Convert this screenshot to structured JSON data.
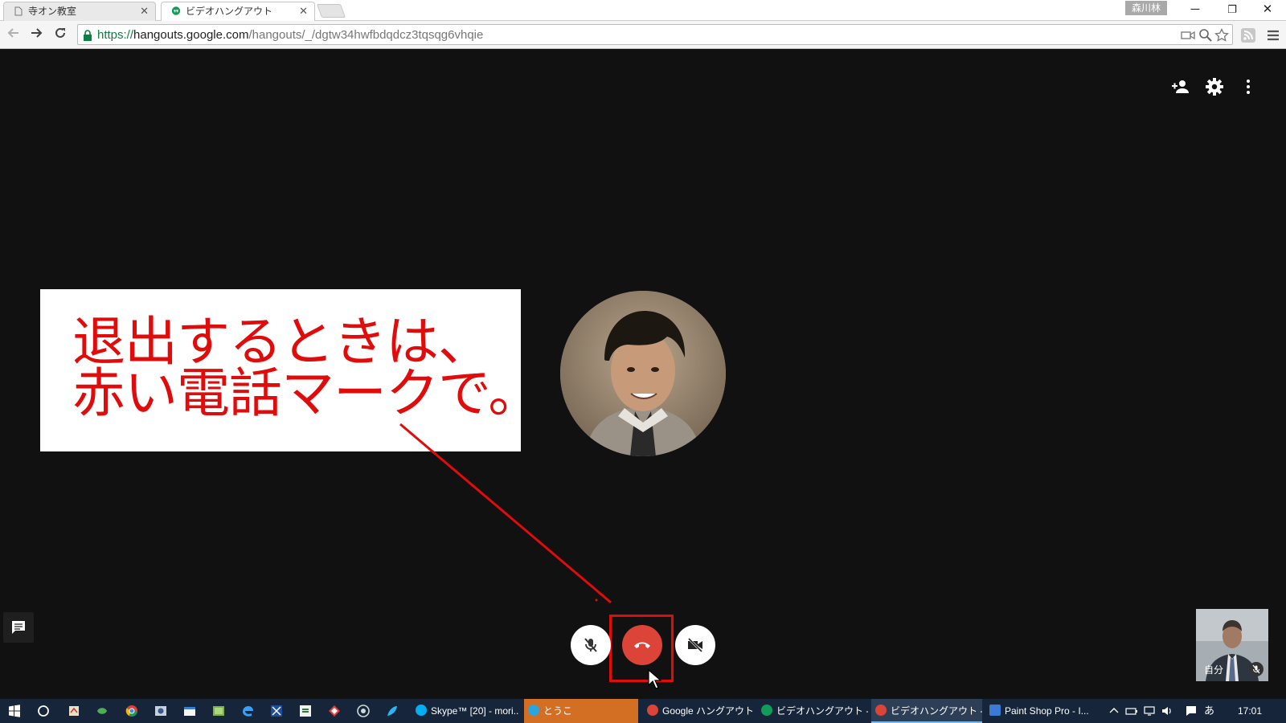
{
  "browser": {
    "tabs": [
      {
        "title": "寺オン教室",
        "active": false
      },
      {
        "title": "ビデオハングアウト",
        "active": true
      }
    ],
    "user_chip": "森川林",
    "url": {
      "scheme": "https://",
      "host": "hangouts.google.com",
      "path": "/hangouts/_/dgtw34hwfbdqdcz3tqsqg6vhqie"
    },
    "window_controls": {
      "minimize": "─",
      "restore": "❐",
      "close": "✕"
    }
  },
  "callout": {
    "line1": "退出するときは、",
    "line2": "赤い電話マークで。",
    "color": "#e00b0b"
  },
  "call_controls": {
    "mute_icon": "mic-off-icon",
    "hangup_icon": "phone-hangup-icon",
    "video_icon": "video-off-icon",
    "hangup_color": "#db4437"
  },
  "self_view": {
    "label": "自分"
  },
  "taskbar": {
    "tasks": [
      {
        "label": "Skype™ [20] - mori...",
        "icon_color": "#00aff0",
        "style": "normal"
      },
      {
        "label": "とうこ",
        "icon_color": "#2aa5e0",
        "style": "orange"
      },
      {
        "label": "Google ハングアウト...",
        "icon_color": "#4caf50",
        "style": "normal"
      },
      {
        "label": "ビデオハングアウト - G...",
        "icon_color": "#0f9d58",
        "style": "normal"
      },
      {
        "label": "ビデオハングアウト - G...",
        "icon_color": "#4caf50",
        "style": "active"
      },
      {
        "label": "Paint Shop Pro - I...",
        "icon_color": "#3a7bd5",
        "style": "normal"
      }
    ],
    "ime": "あ",
    "clock": "17:01"
  }
}
